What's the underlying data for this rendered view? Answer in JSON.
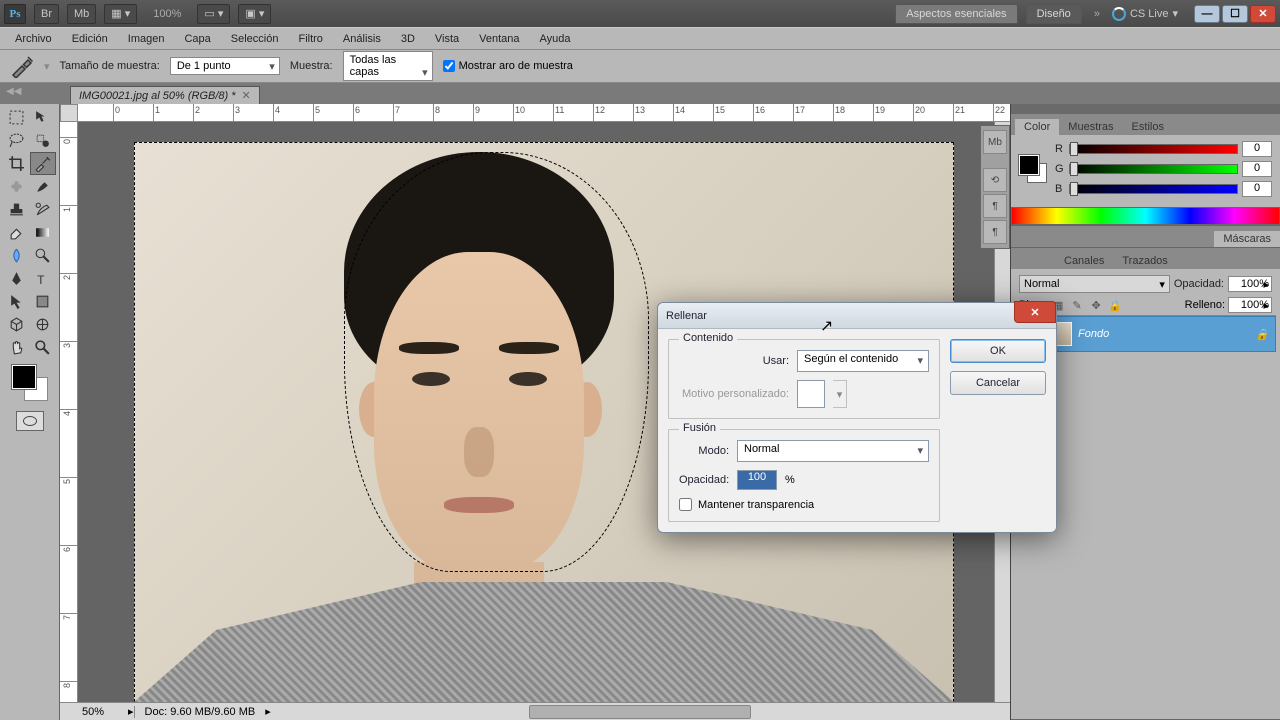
{
  "titlebar": {
    "zoom": "100%",
    "workspace_essentials": "Aspectos esenciales",
    "workspace_design": "Diseño",
    "cslive": "CS Live"
  },
  "menu": [
    "Archivo",
    "Edición",
    "Imagen",
    "Capa",
    "Selección",
    "Filtro",
    "Análisis",
    "3D",
    "Vista",
    "Ventana",
    "Ayuda"
  ],
  "options": {
    "sample_size_label": "Tamaño de muestra:",
    "sample_size_value": "De 1 punto",
    "sample_label": "Muestra:",
    "sample_value": "Todas las capas",
    "show_ring": "Mostrar aro de muestra"
  },
  "doc_tab": "IMG00021.jpg al 50% (RGB/8) *",
  "ruler_h": [
    "0",
    "1",
    "2",
    "3",
    "4",
    "5",
    "6",
    "7",
    "8",
    "9",
    "10",
    "11",
    "12",
    "13",
    "14",
    "15",
    "16",
    "17",
    "18",
    "19",
    "20",
    "21",
    "22"
  ],
  "ruler_v": [
    "0",
    "1",
    "2",
    "3",
    "4",
    "5",
    "6",
    "7",
    "8"
  ],
  "status": {
    "zoom": "50%",
    "doc": "Doc: 9.60 MB/9.60 MB"
  },
  "panels": {
    "color_tabs": [
      "Color",
      "Muestras",
      "Estilos"
    ],
    "color": {
      "r": "0",
      "g": "0",
      "b": "0"
    },
    "masks_tab": "Máscaras",
    "layer_tabs": [
      "Canales",
      "Trazados"
    ],
    "layer_mode": "Normal",
    "opacity_label": "Opacidad:",
    "opacity_val": "100%",
    "fill_label": "Relleno:",
    "fill_val": "100%",
    "lock_label": "Bloq.:",
    "layer_name": "Fondo"
  },
  "dialog": {
    "title": "Rellenar",
    "ok": "OK",
    "cancel": "Cancelar",
    "content_legend": "Contenido",
    "use_label": "Usar:",
    "use_value": "Según el contenido",
    "pattern_label": "Motivo personalizado:",
    "blend_legend": "Fusión",
    "mode_label": "Modo:",
    "mode_value": "Normal",
    "opacity_label": "Opacidad:",
    "opacity_value": "100",
    "opacity_pct": "%",
    "preserve_trans": "Mantener transparencia"
  }
}
